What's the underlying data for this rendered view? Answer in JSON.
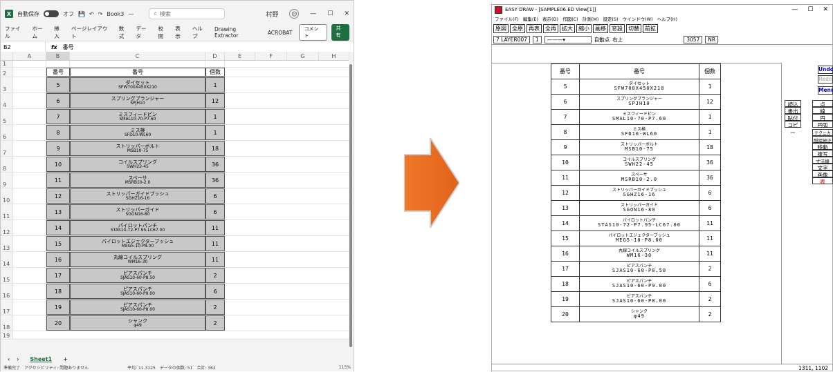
{
  "excel": {
    "autosave_label": "自動保存",
    "toggle_state": "オフ",
    "book_title": "Book3",
    "title_suffix": "—",
    "search_placeholder": "検索",
    "user": "村野",
    "ribbon_tabs": [
      "ファイル",
      "ホーム",
      "挿入",
      "ページレイアウト",
      "数式",
      "データ",
      "校閲",
      "表示",
      "ヘルプ",
      "Drawing Extractor",
      "ACROBAT"
    ],
    "comment_label": "コメント",
    "share_label": "共有",
    "name_box": "B2",
    "formula_value": "番号",
    "columns": [
      "A",
      "B",
      "C",
      "D",
      "E",
      "F",
      "G",
      "H"
    ],
    "table_header": {
      "no": "番号",
      "name": "番号",
      "count": "個数"
    },
    "rows": [
      {
        "no": "5",
        "name": "ダイセット",
        "code": "SFW700X450X210",
        "count": "1"
      },
      {
        "no": "6",
        "name": "スプリングプランジャー",
        "code": "SPJH10",
        "count": "12"
      },
      {
        "no": "7",
        "name": "ミスフィードピン",
        "code": "SMAL10-70-P7.60",
        "count": "1"
      },
      {
        "no": "8",
        "name": "ミス検",
        "code": "SFD10-WL60",
        "count": "1"
      },
      {
        "no": "9",
        "name": "ストリッパーボルト",
        "code": "MSB10-75",
        "count": "18"
      },
      {
        "no": "10",
        "name": "コイルスプリング",
        "code": "SWH22-45",
        "count": "36"
      },
      {
        "no": "11",
        "name": "スペーサ",
        "code": "MSRB10-2.0",
        "count": "36"
      },
      {
        "no": "12",
        "name": "ストリッパーガイドブッシュ",
        "code": "SGHZ16-16",
        "count": "6"
      },
      {
        "no": "13",
        "name": "ストリッパーガイド",
        "code": "SGON16-80",
        "count": "6"
      },
      {
        "no": "14",
        "name": "パイロットパンチ",
        "code": "STAS10-72-P7.95-LC67.00",
        "count": "11"
      },
      {
        "no": "15",
        "name": "パイロットエジェクターブッシュ",
        "code": "MEG5-10-P8.00",
        "count": "11"
      },
      {
        "no": "16",
        "name": "丸線コイルスプリング",
        "code": "WM16-30",
        "count": "11"
      },
      {
        "no": "17",
        "name": "ピアスパンチ",
        "code": "SJAS10-60-P8.50",
        "count": "2"
      },
      {
        "no": "18",
        "name": "ピアスパンチ",
        "code": "SJAS10-60-P9.00",
        "count": "6"
      },
      {
        "no": "19",
        "name": "ピアスパンチ",
        "code": "SJAS10-60-P8.00",
        "count": "2"
      },
      {
        "no": "20",
        "name": "シャンク",
        "code": "φ49",
        "count": "2"
      }
    ],
    "sheet_tab": "Sheet1",
    "status_items": [
      "準備完了",
      "アクセシビリティ: 問題ありません",
      "平均: 11.3125",
      "データの個数: 51",
      "合計: 362"
    ],
    "zoom": "115%"
  },
  "easydraw": {
    "title": "EASY DRAW - [SAMPLE06.ED View[1]]",
    "menu": [
      "ファイル(F)",
      "編集(E)",
      "表示(D)",
      "作図(C)",
      "計測(M)",
      "設定(S)",
      "ウインドウ(W)",
      "ヘルプ(H)"
    ],
    "tools": [
      "原図",
      "全原",
      "再表",
      "全再",
      "拡大",
      "縮小",
      "画移",
      "窓設",
      "切替",
      "前拡"
    ],
    "layer": "7 LAYER007",
    "layer_num": "1",
    "snap": "自動点",
    "align": "右上",
    "coord": "3057",
    "nr": "NR",
    "table_header": {
      "no": "番号",
      "name": "番号",
      "count": "個数"
    },
    "rows": [
      {
        "no": "5",
        "name": "ダイセット",
        "code": "SFW700X450X210",
        "count": "1"
      },
      {
        "no": "6",
        "name": "スプリングプランジャー",
        "code": "SPJH10",
        "count": "12"
      },
      {
        "no": "7",
        "name": "ミスフィードピン",
        "code": "SMAL10-70-P7.60",
        "count": "1"
      },
      {
        "no": "8",
        "name": "ミス検",
        "code": "SFD10-WL60",
        "count": "1"
      },
      {
        "no": "9",
        "name": "ストリッパーボルト",
        "code": "MSB10-75",
        "count": "18"
      },
      {
        "no": "10",
        "name": "コイルスプリング",
        "code": "SWH22-45",
        "count": "36"
      },
      {
        "no": "11",
        "name": "スペーサ",
        "code": "MSRB10-2.0",
        "count": "36"
      },
      {
        "no": "12",
        "name": "ストリッパーガイドブッシュ",
        "code": "SGHZ16-16",
        "count": "6"
      },
      {
        "no": "13",
        "name": "ストリッパーガイド",
        "code": "SGON16-80",
        "count": "6"
      },
      {
        "no": "14",
        "name": "パイロットパンチ",
        "code": "STAS10-72-P7.95-LC67.00",
        "count": "11"
      },
      {
        "no": "15",
        "name": "パイロットエジェクターブッシュ",
        "code": "MEG5-10-P8.00",
        "count": "11"
      },
      {
        "no": "16",
        "name": "丸線コイルスプリング",
        "code": "WM16-30",
        "count": "11"
      },
      {
        "no": "17",
        "name": "ピアスパンチ",
        "code": "SJAS10-60-P8.50",
        "count": "2"
      },
      {
        "no": "18",
        "name": "ピアスパンチ",
        "code": "SJAS10-60-P9.00",
        "count": "6"
      },
      {
        "no": "19",
        "name": "ピアスパンチ",
        "code": "SJAS10-60-P8.00",
        "count": "2"
      },
      {
        "no": "20",
        "name": "シャンク",
        "code": "φ49",
        "count": "2"
      }
    ],
    "side_buttons": {
      "undo": "Undo",
      "redo": "Redo",
      "menu": "Menu",
      "left": [
        "読込",
        "書出",
        "貼付",
        "コピー"
      ],
      "right": [
        "点",
        "線",
        "円",
        "円弧"
      ],
      "col": [
        "テクニカル",
        "削除修正",
        "移動",
        "複写",
        "寸法線",
        "文字",
        "画像",
        "表"
      ]
    },
    "status_coord": "1311,   1102",
    "accent_color": "#0000cc",
    "table_red": "#cc0000"
  }
}
